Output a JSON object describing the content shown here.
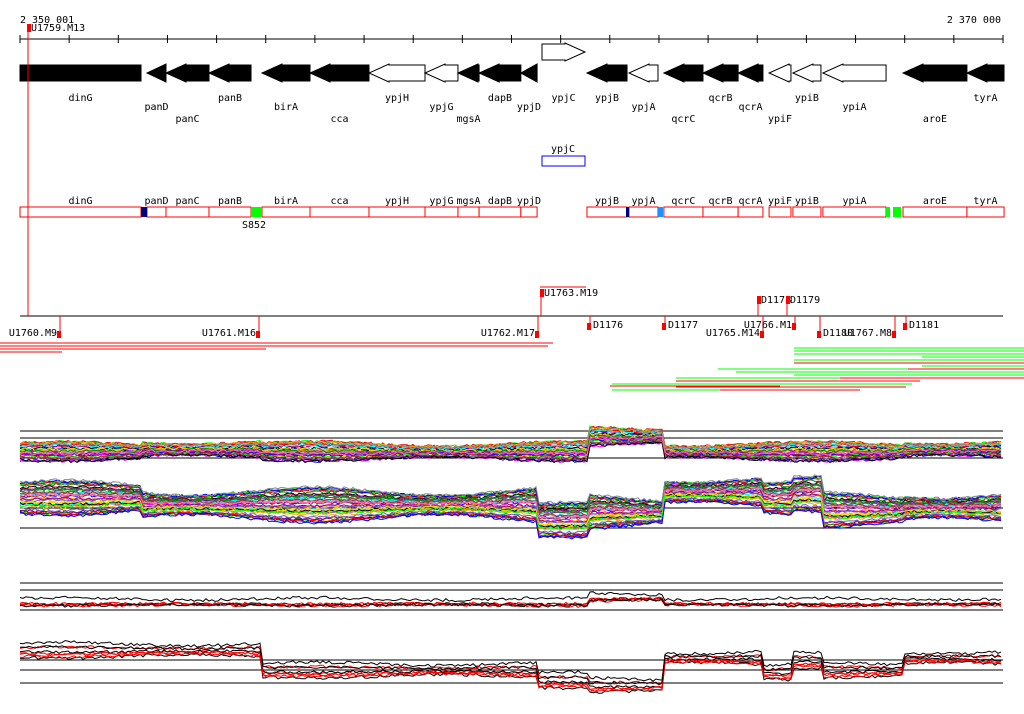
{
  "axis": {
    "start_label": "2 350 001",
    "end_label": "2 370 000",
    "start": 2350001,
    "end": 2370000
  },
  "genes": [
    {
      "name": "dinG",
      "start": 2350001,
      "end": 2352463,
      "strand": "none",
      "fill": "black"
    },
    {
      "name": "panD",
      "start": 2352585,
      "end": 2352971,
      "strand": "-",
      "fill": "black"
    },
    {
      "name": "panC",
      "start": 2352971,
      "end": 2353846,
      "strand": "-",
      "fill": "black"
    },
    {
      "name": "panB",
      "start": 2353846,
      "end": 2354701,
      "strand": "-",
      "fill": "black"
    },
    {
      "name": "birA",
      "start": 2354924,
      "end": 2355901,
      "strand": "-",
      "fill": "black"
    },
    {
      "name": "cca",
      "start": 2355901,
      "end": 2357101,
      "strand": "-",
      "fill": "black"
    },
    {
      "name": "ypjH",
      "start": 2357101,
      "end": 2358241,
      "strand": "-",
      "fill": "white"
    },
    {
      "name": "ypjG",
      "start": 2358241,
      "end": 2358911,
      "strand": "-",
      "fill": "white"
    },
    {
      "name": "mgsA",
      "start": 2358911,
      "end": 2359341,
      "strand": "-",
      "fill": "black"
    },
    {
      "name": "dapB",
      "start": 2359341,
      "end": 2360191,
      "strand": "-",
      "fill": "black"
    },
    {
      "name": "ypjD",
      "start": 2360191,
      "end": 2360521,
      "strand": "-",
      "fill": "black"
    },
    {
      "name": "ypjC",
      "start": 2360621,
      "end": 2361496,
      "strand": "+",
      "fill": "white"
    },
    {
      "name": "ypjB",
      "start": 2361536,
      "end": 2362351,
      "strand": "-",
      "fill": "black"
    },
    {
      "name": "ypjA",
      "start": 2362391,
      "end": 2362981,
      "strand": "-",
      "fill": "white"
    },
    {
      "name": "qcrC",
      "start": 2363101,
      "end": 2363896,
      "strand": "-",
      "fill": "black"
    },
    {
      "name": "qcrB",
      "start": 2363896,
      "end": 2364611,
      "strand": "-",
      "fill": "black"
    },
    {
      "name": "qcrA",
      "start": 2364611,
      "end": 2365116,
      "strand": "-",
      "fill": "black"
    },
    {
      "name": "ypiF",
      "start": 2365241,
      "end": 2365686,
      "strand": "-",
      "fill": "white"
    },
    {
      "name": "ypiB",
      "start": 2365726,
      "end": 2366296,
      "strand": "-",
      "fill": "white"
    },
    {
      "name": "ypiA",
      "start": 2366336,
      "end": 2367621,
      "strand": "-",
      "fill": "white"
    },
    {
      "name": "aroE",
      "start": 2367966,
      "end": 2369266,
      "strand": "-",
      "fill": "black"
    },
    {
      "name": "tyrA",
      "start": 2369266,
      "end": 2370021,
      "strand": "-",
      "fill": "black"
    }
  ],
  "highlight_gene": "ypjC",
  "site_label": "S852",
  "features_above": [
    "U1759.M13",
    "U1763.M19",
    "D1178",
    "D1179"
  ],
  "features_below": [
    "U1760.M9",
    "U1761.M16",
    "U1762.M17",
    "D1176",
    "D1177",
    "U1765.M14",
    "U1766.M1",
    "D1180",
    "U1767.M8",
    "D1181"
  ],
  "colors": {
    "gene_box": "#ff0000",
    "marker_navy": "#000080",
    "marker_blue": "#1e90ff",
    "marker_green": "#00ff00",
    "highlight": "#0000ff",
    "feature": "#ff0000"
  }
}
